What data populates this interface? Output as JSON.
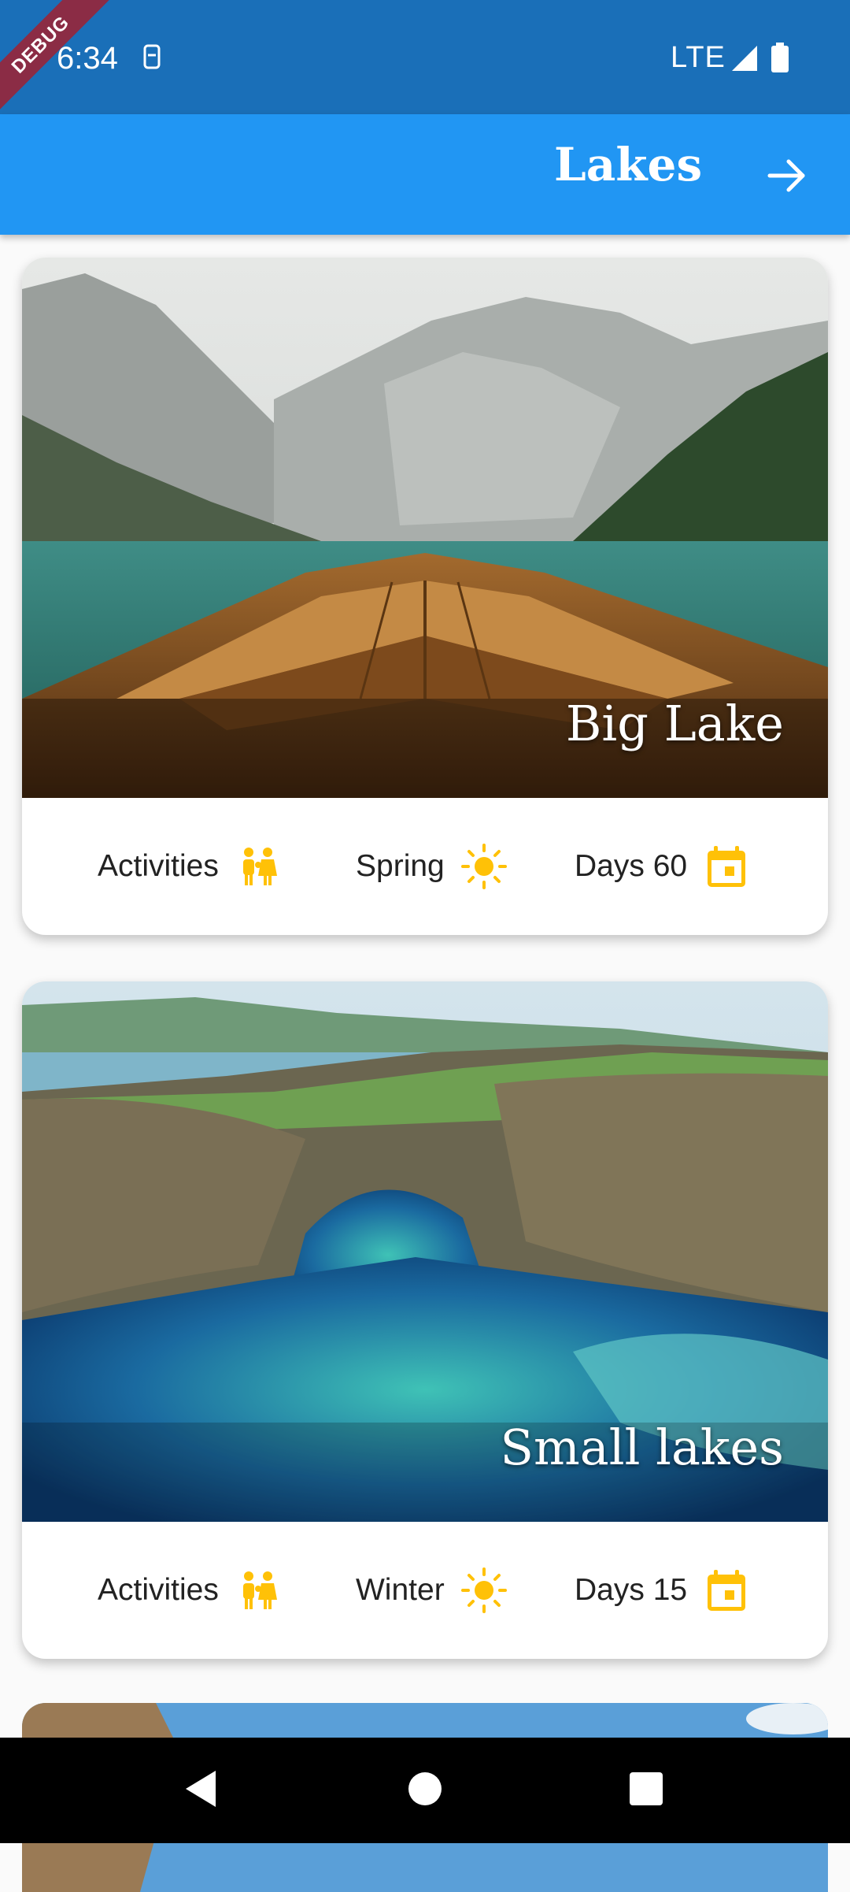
{
  "status_bar": {
    "time": "6:34",
    "network": "LTE",
    "debug_banner": "DEBUG"
  },
  "app_bar": {
    "title": "Lakes",
    "action_icon": "arrow-forward-icon"
  },
  "cards": [
    {
      "title": "Big Lake",
      "activities_label": "Activities",
      "season_label": "Spring",
      "days_label": "Days 60"
    },
    {
      "title": "Small lakes",
      "activities_label": "Activities",
      "season_label": "Winter",
      "days_label": "Days 15"
    }
  ],
  "colors": {
    "app_bar": "#2196f3",
    "status_bar": "#1a6fb8",
    "icon_amber": "#ffc107"
  },
  "icons": [
    "people-icon",
    "sun-icon",
    "calendar-icon"
  ],
  "nav_bar": [
    "back-icon",
    "home-icon",
    "recents-icon"
  ]
}
